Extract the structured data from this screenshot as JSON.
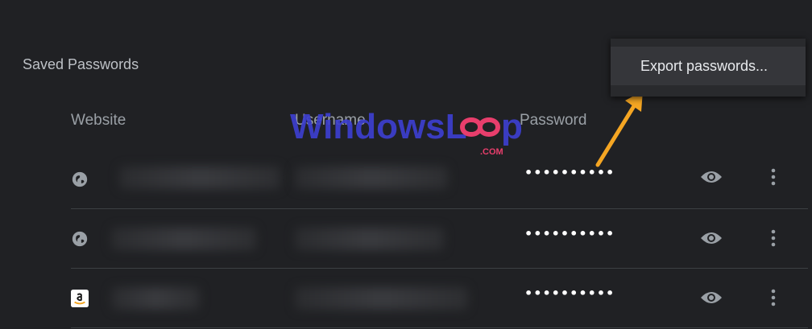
{
  "section": {
    "title": "Saved Passwords"
  },
  "columns": {
    "website": "Website",
    "username": "Username",
    "password": "Password"
  },
  "rows": [
    {
      "icon": "globe-icon",
      "password_mask": "••••••••••"
    },
    {
      "icon": "globe-icon",
      "password_mask": "••••••••••"
    },
    {
      "icon": "amazon-logo-icon",
      "password_mask": "••••••••••"
    }
  ],
  "menu": {
    "export_label": "Export passwords..."
  },
  "watermark": {
    "text_windows": "WindowsL",
    "text_loop": "p",
    "text_suffix": ".COM"
  },
  "colors": {
    "background": "#202124",
    "menu": "#292a2d",
    "arrow": "#f5a623",
    "watermark_blue": "#3d3fcf",
    "watermark_pink": "#e83e6c"
  }
}
